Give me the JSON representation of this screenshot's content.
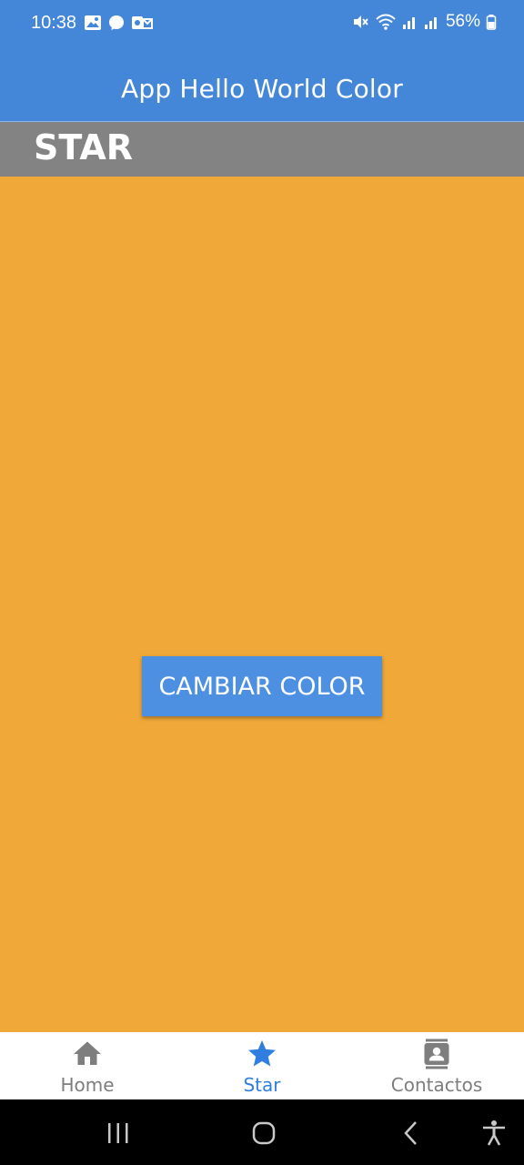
{
  "status_bar": {
    "time": "10:38",
    "battery": "56%",
    "notification_icons": [
      "gallery-icon",
      "messenger-icon",
      "outlook-icon"
    ],
    "system_icons": [
      "mute-icon",
      "wifi-icon",
      "signal-icon",
      "signal-icon",
      "battery-icon"
    ]
  },
  "app_bar": {
    "title": "App Hello World Color",
    "color": "#4487d8"
  },
  "section": {
    "title": "STAR",
    "color": "#838383"
  },
  "content": {
    "background_color": "#f0a839",
    "button_label": "CAMBIAR COLOR",
    "button_color": "#4d90e2"
  },
  "bottom_nav": {
    "items": [
      {
        "label": "Home",
        "icon": "home-icon",
        "active": false
      },
      {
        "label": "Star",
        "icon": "star-icon",
        "active": true
      },
      {
        "label": "Contactos",
        "icon": "contacts-icon",
        "active": false
      }
    ],
    "active_color": "#2f7ee0",
    "inactive_color": "#7e7e7e"
  },
  "system_nav": {
    "icons": [
      "recent-apps-icon",
      "home-circle-icon",
      "back-icon",
      "accessibility-icon"
    ]
  }
}
